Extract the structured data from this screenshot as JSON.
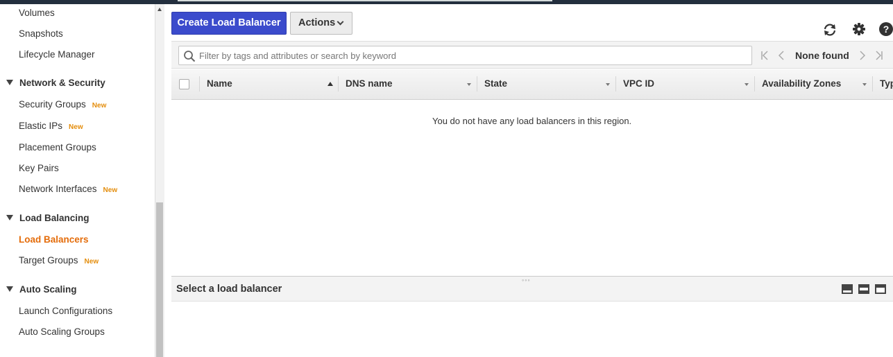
{
  "sidebar": {
    "items": [
      {
        "label": "Volumes"
      },
      {
        "label": "Snapshots"
      },
      {
        "label": "Lifecycle Manager"
      }
    ],
    "sections": [
      {
        "title": "Network & Security",
        "items": [
          {
            "label": "Security Groups",
            "badge": "New"
          },
          {
            "label": "Elastic IPs",
            "badge": "New"
          },
          {
            "label": "Placement Groups"
          },
          {
            "label": "Key Pairs"
          },
          {
            "label": "Network Interfaces",
            "badge": "New"
          }
        ]
      },
      {
        "title": "Load Balancing",
        "items": [
          {
            "label": "Load Balancers",
            "active": true
          },
          {
            "label": "Target Groups",
            "badge": "New"
          }
        ]
      },
      {
        "title": "Auto Scaling",
        "items": [
          {
            "label": "Launch Configurations"
          },
          {
            "label": "Auto Scaling Groups"
          }
        ]
      }
    ]
  },
  "toolbar": {
    "create_label": "Create Load Balancer",
    "actions_label": "Actions",
    "icons": [
      "refresh-icon",
      "gear-icon",
      "help-icon"
    ]
  },
  "filter": {
    "placeholder": "Filter by tags and attributes or search by keyword",
    "pager_text": "None found"
  },
  "table": {
    "columns": [
      "Name",
      "DNS name",
      "State",
      "VPC ID",
      "Availability Zones",
      "Type"
    ],
    "sorted_column": "Name",
    "empty_message": "You do not have any load balancers in this region."
  },
  "details": {
    "title": "Select a load balancer"
  },
  "colors": {
    "primary_button": "#3b4bcc",
    "active_nav": "#e46c0a",
    "new_badge": "#e48d0c",
    "topbar": "#232f3e"
  }
}
